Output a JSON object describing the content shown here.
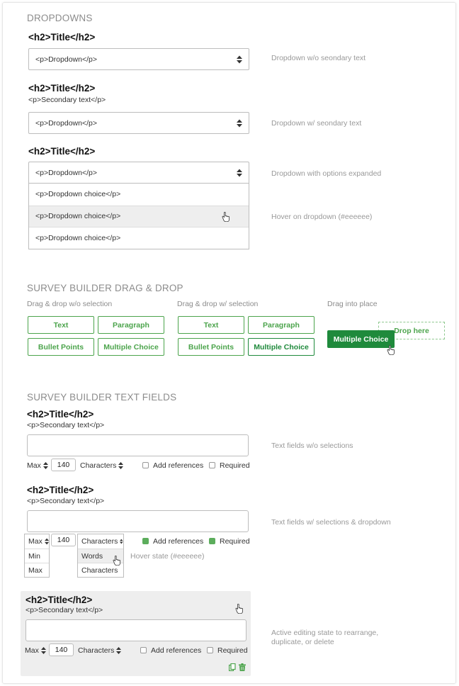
{
  "dropdowns": {
    "section_title": "DROPDOWNS",
    "block1": {
      "title": "<h2>Title</h2>",
      "select": "<p>Dropdown</p>",
      "note": "Dropdown w/o seondary text"
    },
    "block2": {
      "title": "<h2>Title</h2>",
      "secondary": "<p>Secondary text</p>",
      "select": "<p>Dropdown</p>",
      "note": "Dropdown w/ seondary text"
    },
    "block3": {
      "title": "<h2>Title</h2>",
      "select": "<p>Dropdown</p>",
      "note": "Dropdown with options expanded",
      "options": [
        "<p>Dropdown choice</p>",
        "<p>Dropdown choice</p>",
        "<p>Dropdown choice</p>"
      ],
      "hover_note": "Hover on dropdown (#eeeeee)"
    }
  },
  "dragdrop": {
    "section_title": "SURVEY BUILDER DRAG & DROP",
    "col1": {
      "label": "Drag & drop w/o selection",
      "buttons": [
        "Text",
        "Paragraph",
        "Bullet Points",
        "Multiple Choice"
      ]
    },
    "col2": {
      "label": "Drag & drop w/ selection",
      "buttons": [
        "Text",
        "Paragraph",
        "Bullet Points",
        "Multiple Choice"
      ]
    },
    "col3": {
      "label": "Drag into place",
      "dragging": "Multiple Choice",
      "drop_here": "Drop here"
    }
  },
  "textfields": {
    "section_title": "SURVEY BUILDER TEXT FIELDS",
    "block1": {
      "title": "<h2>Title</h2>",
      "secondary": "<p>Secondary text</p>",
      "max": "Max",
      "value": "140",
      "unit": "Characters",
      "add_refs": "Add references",
      "required": "Required",
      "note": "Text fields w/o selections"
    },
    "block2": {
      "title": "<h2>Title</h2>",
      "secondary": "<p>Secondary text</p>",
      "max": "Max",
      "value": "140",
      "unit": "Characters",
      "add_refs": "Add references",
      "required": "Required",
      "note": "Text fields w/ selections & dropdown",
      "max_options": [
        "Min",
        "Max"
      ],
      "unit_options": [
        "Words",
        "Characters"
      ],
      "hover_note": "Hover state (#eeeeee)"
    },
    "block3": {
      "title": "<h2>Title</h2>",
      "secondary": "<p>Secondary text</p>",
      "max": "Max",
      "value": "140",
      "unit": "Characters",
      "add_refs": "Add references",
      "required": "Required",
      "note": "Active editing state to rearrange, duplicate, or delete"
    }
  },
  "icons": {
    "select_arrows": "sort-icon",
    "pointer": "hand-pointer-icon",
    "duplicate": "copy-icon",
    "delete": "trash-icon"
  },
  "colors": {
    "green": "#4ca44c",
    "green_dark": "#1f8a3c",
    "hover": "#eeeeee",
    "active_bg": "#eeeeee"
  }
}
